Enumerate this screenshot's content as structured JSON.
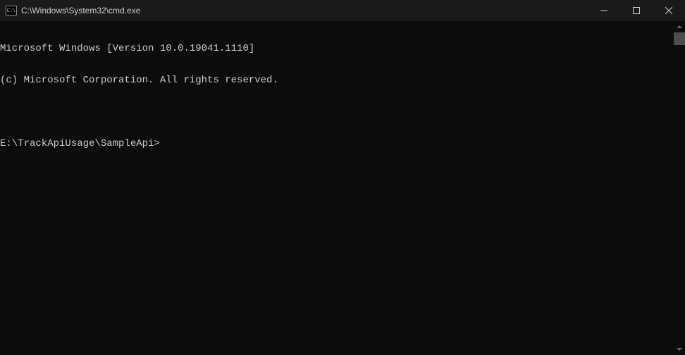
{
  "titlebar": {
    "icon_text": "C:\\",
    "title": "C:\\Windows\\System32\\cmd.exe"
  },
  "terminal": {
    "lines": [
      "Microsoft Windows [Version 10.0.19041.1110]",
      "(c) Microsoft Corporation. All rights reserved.",
      "",
      "E:\\TrackApiUsage\\SampleApi>"
    ]
  }
}
